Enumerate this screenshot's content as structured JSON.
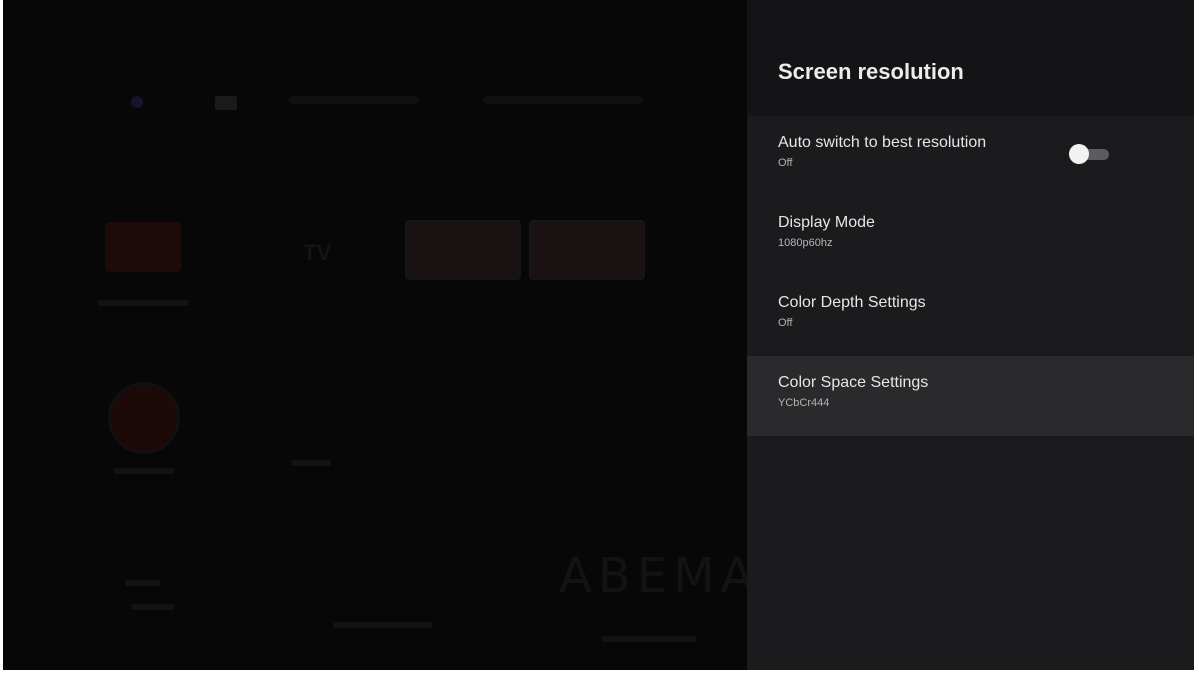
{
  "panel": {
    "title": "Screen resolution",
    "items": [
      {
        "label": "Auto switch to best resolution",
        "value": "Off",
        "toggle": "off"
      },
      {
        "label": "Display Mode",
        "value": "1080p60hz"
      },
      {
        "label": "Color Depth Settings",
        "value": "Off"
      },
      {
        "label": "Color Space Settings",
        "value": "YCbCr444",
        "focused": true
      }
    ]
  },
  "background": {
    "tv_label": "TV",
    "brand_text": "ABEMA"
  },
  "colors": {
    "panel_bg": "#1b1b1e",
    "header_bg": "#141416",
    "focused_bg": "#2a2a2d",
    "screen_bg": "#060608"
  }
}
